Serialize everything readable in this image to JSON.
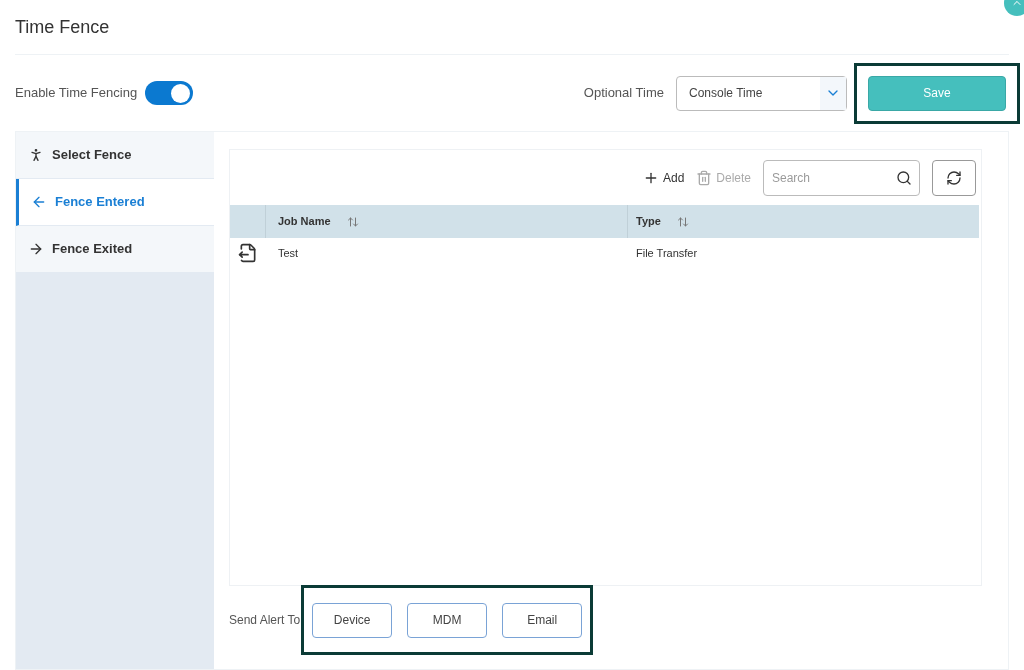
{
  "title": "Time Fence",
  "enable": {
    "label": "Enable Time Fencing",
    "on": true
  },
  "optional_time": {
    "label": "Optional Time",
    "value": "Console Time"
  },
  "save_button": "Save",
  "tabs": [
    {
      "label": "Select Fence",
      "kind": "select",
      "selected": false
    },
    {
      "label": "Fence Entered",
      "kind": "enter",
      "selected": true
    },
    {
      "label": "Fence Exited",
      "kind": "exit",
      "selected": false
    }
  ],
  "toolbar": {
    "add": "Add",
    "delete": "Delete",
    "search_placeholder": "Search"
  },
  "table": {
    "columns": [
      "Job Name",
      "Type"
    ],
    "rows": [
      {
        "job_name": "Test",
        "type": "File Transfer"
      }
    ]
  },
  "send_alert": {
    "label": "Send Alert To",
    "buttons": [
      "Device",
      "MDM",
      "Email"
    ]
  }
}
